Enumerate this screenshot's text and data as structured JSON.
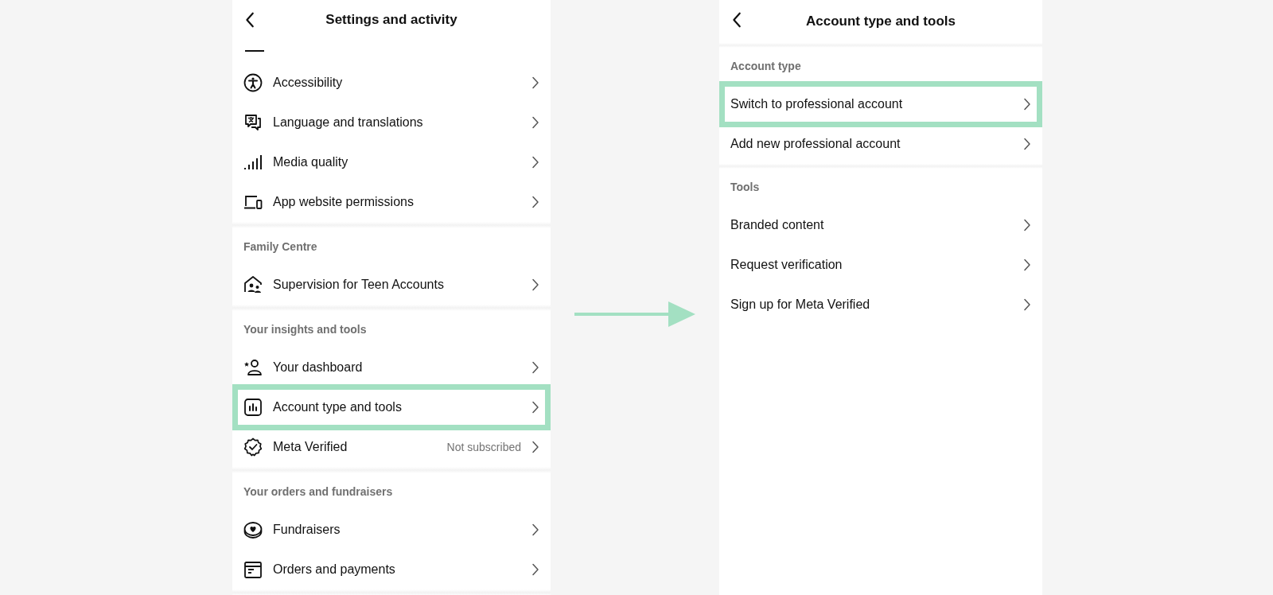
{
  "left_screen": {
    "title": "Settings and activity",
    "sections": [
      {
        "items": [
          {
            "label": "Accessibility",
            "highlighted": false
          },
          {
            "label": "Language and translations",
            "highlighted": false
          },
          {
            "label": "Media quality",
            "highlighted": false
          },
          {
            "label": "App website permissions",
            "highlighted": false
          }
        ]
      },
      {
        "header": "Family Centre",
        "items": [
          {
            "label": "Supervision for Teen Accounts",
            "highlighted": false
          }
        ]
      },
      {
        "header": "Your insights and tools",
        "items": [
          {
            "label": "Your dashboard",
            "highlighted": false
          },
          {
            "label": "Account type and tools",
            "highlighted": true
          },
          {
            "label": "Meta Verified",
            "value": "Not subscribed",
            "highlighted": false
          }
        ]
      },
      {
        "header": "Your orders and fundraisers",
        "items": [
          {
            "label": "Fundraisers",
            "highlighted": false
          },
          {
            "label": "Orders and payments",
            "highlighted": false
          }
        ]
      }
    ]
  },
  "right_screen": {
    "title": "Account type and tools",
    "sections": [
      {
        "header": "Account type",
        "items": [
          {
            "label": "Switch to professional account",
            "highlighted": true
          },
          {
            "label": "Add new professional account",
            "highlighted": false
          }
        ]
      },
      {
        "header": "Tools",
        "items": [
          {
            "label": "Branded content",
            "highlighted": false
          },
          {
            "label": "Request verification",
            "highlighted": false
          },
          {
            "label": "Sign up for Meta Verified",
            "highlighted": false
          }
        ]
      }
    ]
  }
}
